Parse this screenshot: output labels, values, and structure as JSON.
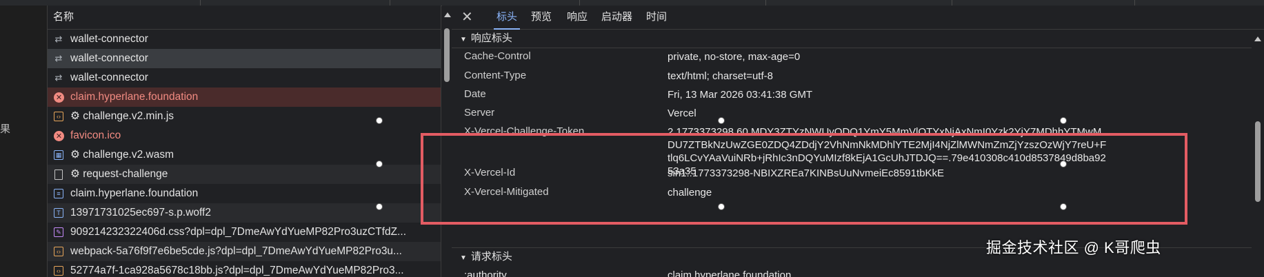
{
  "sidebar": {
    "result_char": "果"
  },
  "request_list": {
    "column_header": "名称",
    "rows": [
      {
        "name": "wallet-connector",
        "icon": "websocket-icon",
        "state": "normal"
      },
      {
        "name": "wallet-connector",
        "icon": "websocket-icon",
        "state": "selected"
      },
      {
        "name": "wallet-connector",
        "icon": "websocket-icon",
        "state": "normal"
      },
      {
        "name": "claim.hyperlane.foundation",
        "icon": "error-icon",
        "state": "error"
      },
      {
        "name": "⚙ challenge.v2.min.js",
        "icon": "script-icon",
        "state": "normal"
      },
      {
        "name": "favicon.ico",
        "icon": "error-icon",
        "state": "errorplain"
      },
      {
        "name": "⚙ challenge.v2.wasm",
        "icon": "wasm-icon",
        "state": "normal"
      },
      {
        "name": "⚙ request-challenge",
        "icon": "document-icon",
        "state": "normal"
      },
      {
        "name": "claim.hyperlane.foundation",
        "icon": "doc-lines-icon",
        "state": "normal"
      },
      {
        "name": "13971731025ec697-s.p.woff2",
        "icon": "font-icon",
        "state": "normal"
      },
      {
        "name": "909214232322406d.css?dpl=dpl_7DmeAwYdYueMP82Pro3uzCTfdZ...",
        "icon": "stylesheet-icon",
        "state": "normal"
      },
      {
        "name": "webpack-5a76f9f7e6be5cde.js?dpl=dpl_7DmeAwYdYueMP82Pro3u...",
        "icon": "script-icon",
        "state": "normal"
      },
      {
        "name": "52774a7f-1ca928a5678c18bb.js?dpl=dpl_7DmeAwYdYueMP82Pro3...",
        "icon": "script-icon",
        "state": "normal"
      }
    ]
  },
  "detail": {
    "tabs": [
      "标头",
      "预览",
      "响应",
      "启动器",
      "时间"
    ],
    "active_tab": "标头",
    "response_section": "响应标头",
    "request_section": "请求标头",
    "headers": [
      {
        "name": "Cache-Control",
        "value": "private, no-store, max-age=0"
      },
      {
        "name": "Content-Type",
        "value": "text/html; charset=utf-8"
      },
      {
        "name": "Date",
        "value": "Fri, 13 Mar 2026 03:41:38 GMT"
      },
      {
        "name": "Server",
        "value": "Vercel"
      },
      {
        "name": "X-Vercel-Challenge-Token",
        "value": "2.1773373298.60.MDY3ZTYzNWUyODQ1YmY5MmVlOTYxNjAxNmI0Yzk2YjY7MDhhYTMwMDU7ZTBkNzUwZGE0ZDQ4ZDdjY2VhNmNkMDhlYTE2MjI4NjZlMWNmZmZjYzszOzWjY7reU+Ftlq6LCvYAaVuiNRb+jRhIc3nDQYuMIzf8kEjA1GcUhJTDJQ==.79e410308c410d8537849d8ba9253a35"
      },
      {
        "name": "X-Vercel-Id",
        "value": "sin1::1773373298-NBIXZREa7KINBsUuNvmeiEc8591tbKkE"
      },
      {
        "name": "X-Vercel-Mitigated",
        "value": "challenge"
      }
    ],
    "cut_row": {
      "name": ":authority",
      "value": "claim.hyperlane.foundation"
    }
  },
  "watermark": "掘金技术社区 @ K哥爬虫",
  "colors": {
    "accent": "#8ab4f8",
    "error": "#f28b82",
    "highlight": "#e35c63"
  }
}
